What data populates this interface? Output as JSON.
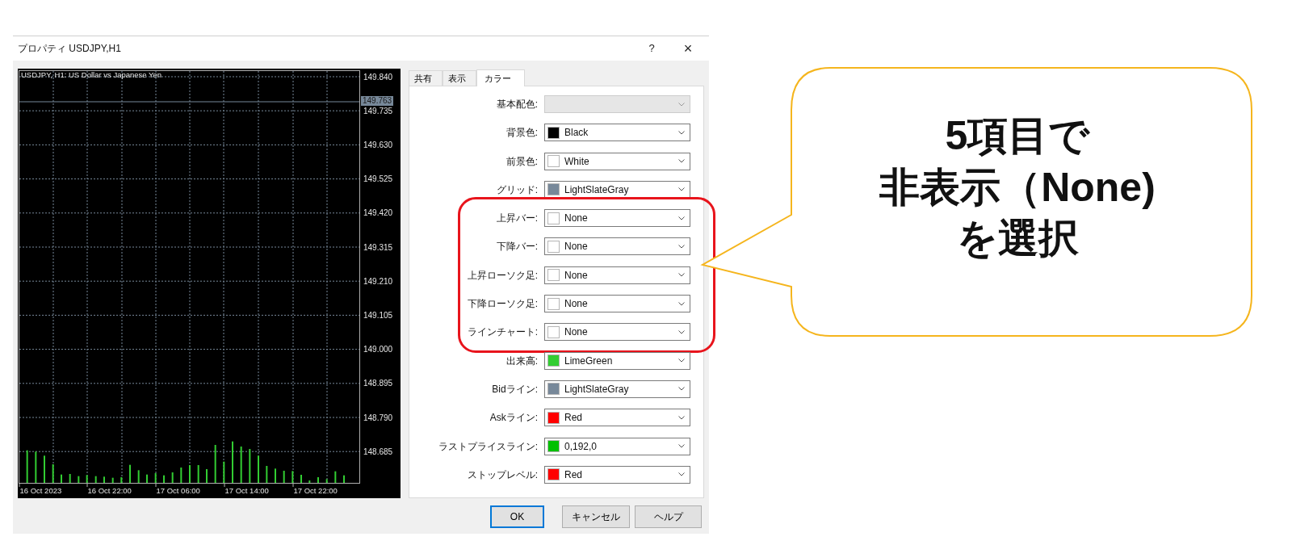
{
  "window": {
    "title": "プロパティ USDJPY,H1",
    "help": "?",
    "close": "×"
  },
  "chart": {
    "title": "USDJPY, H1:  US Dollar vs Japanese Yen",
    "current_price": "149.763",
    "price_labels": [
      "149.840",
      "149.735",
      "149.630",
      "149.525",
      "149.420",
      "149.315",
      "149.210",
      "149.105",
      "149.000",
      "148.895",
      "148.790",
      "148.685"
    ],
    "time_labels": [
      "16 Oct 2023",
      "16 Oct 22:00",
      "17 Oct 06:00",
      "17 Oct 14:00",
      "17 Oct 22:00"
    ]
  },
  "tabs": [
    {
      "label": "共有",
      "selected": false
    },
    {
      "label": "表示",
      "selected": false
    },
    {
      "label": "カラー",
      "selected": true
    }
  ],
  "row_groups": [
    {
      "highlighted": false,
      "rows": [
        {
          "label": "基本配色:",
          "disabled": true
        },
        {
          "label": "背景色:",
          "value": "Black",
          "color": "#000000",
          "disabled": false
        },
        {
          "label": "前景色:",
          "value": "White",
          "color": "#ffffff",
          "disabled": false
        },
        {
          "label": "グリッド:",
          "value": "LightSlateGray",
          "color": "#778899",
          "disabled": false
        }
      ]
    },
    {
      "highlighted": true,
      "rows": [
        {
          "label": "上昇バー:",
          "value": "None",
          "color": "#ffffff",
          "disabled": false
        },
        {
          "label": "下降バー:",
          "value": "None",
          "color": "#ffffff",
          "disabled": false
        },
        {
          "label": "上昇ローソク足:",
          "value": "None",
          "color": "#ffffff",
          "disabled": false
        },
        {
          "label": "下降ローソク足:",
          "value": "None",
          "color": "#ffffff",
          "disabled": false
        },
        {
          "label": "ラインチャート:",
          "value": "None",
          "color": "#ffffff",
          "disabled": false
        }
      ]
    },
    {
      "highlighted": false,
      "rows": [
        {
          "label": "出来高:",
          "value": "LimeGreen",
          "color": "#32cd32",
          "disabled": false
        },
        {
          "label": "Bidライン:",
          "value": "LightSlateGray",
          "color": "#778899",
          "disabled": false
        },
        {
          "label": "Askライン:",
          "value": "Red",
          "color": "#ff0000",
          "disabled": false
        },
        {
          "label": "ラストプライスライン:",
          "value": "0,192,0",
          "color": "#00c000",
          "disabled": false
        },
        {
          "label": "ストップレベル:",
          "value": "Red",
          "color": "#ff0000",
          "disabled": false
        }
      ]
    }
  ],
  "buttons": [
    {
      "label": "OK",
      "default": true
    },
    {
      "label": "キャンセル",
      "default": false
    },
    {
      "label": "ヘルプ",
      "default": false
    }
  ],
  "callout": {
    "lines": [
      "5項目で",
      "非表示（None)",
      "を選択"
    ]
  }
}
